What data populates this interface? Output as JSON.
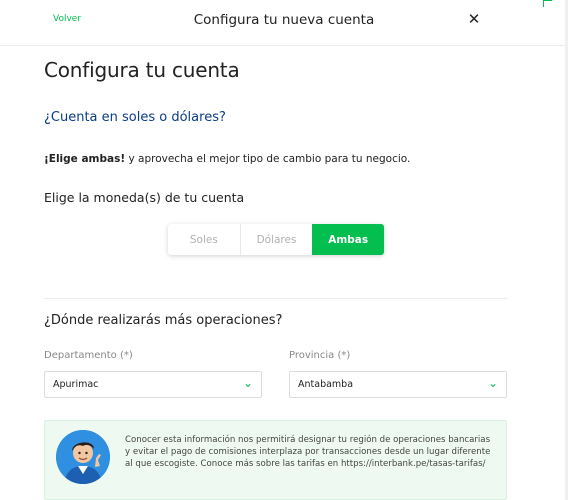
{
  "header": {
    "back_label": "Volver",
    "title": "Configura tu nueva cuenta",
    "close_icon": "close-icon"
  },
  "page": {
    "title": "Configura tu cuenta",
    "currency_question": "¿Cuenta en soles o dólares?",
    "promo_bold": "¡Elige ambas!",
    "promo_rest": " y aprovecha el mejor tipo de cambio para tu negocio.",
    "currency_label": "Elige la moneda(s) de tu cuenta",
    "currency_options": [
      "Soles",
      "Dólares",
      "Ambas"
    ],
    "currency_selected": "Ambas",
    "operations_question": "¿Dónde realizarás más operaciones?"
  },
  "form": {
    "department_label": "Departamento (*)",
    "department_value": "Apurimac",
    "province_label": "Provincia (*)",
    "province_value": "Antabamba"
  },
  "info": {
    "text": "Conocer esta información nos permitirá designar tu región de operaciones bancarias y evitar el pago de comisiones interplaza por transacciones desde un lugar diferente al que escogiste. Conoce más sobre las tarifas en https://interbank.pe/tasas-tarifas/"
  },
  "colors": {
    "accent": "#05be50",
    "link_blue": "#0a3b8c",
    "info_bg": "#eefaf1"
  }
}
